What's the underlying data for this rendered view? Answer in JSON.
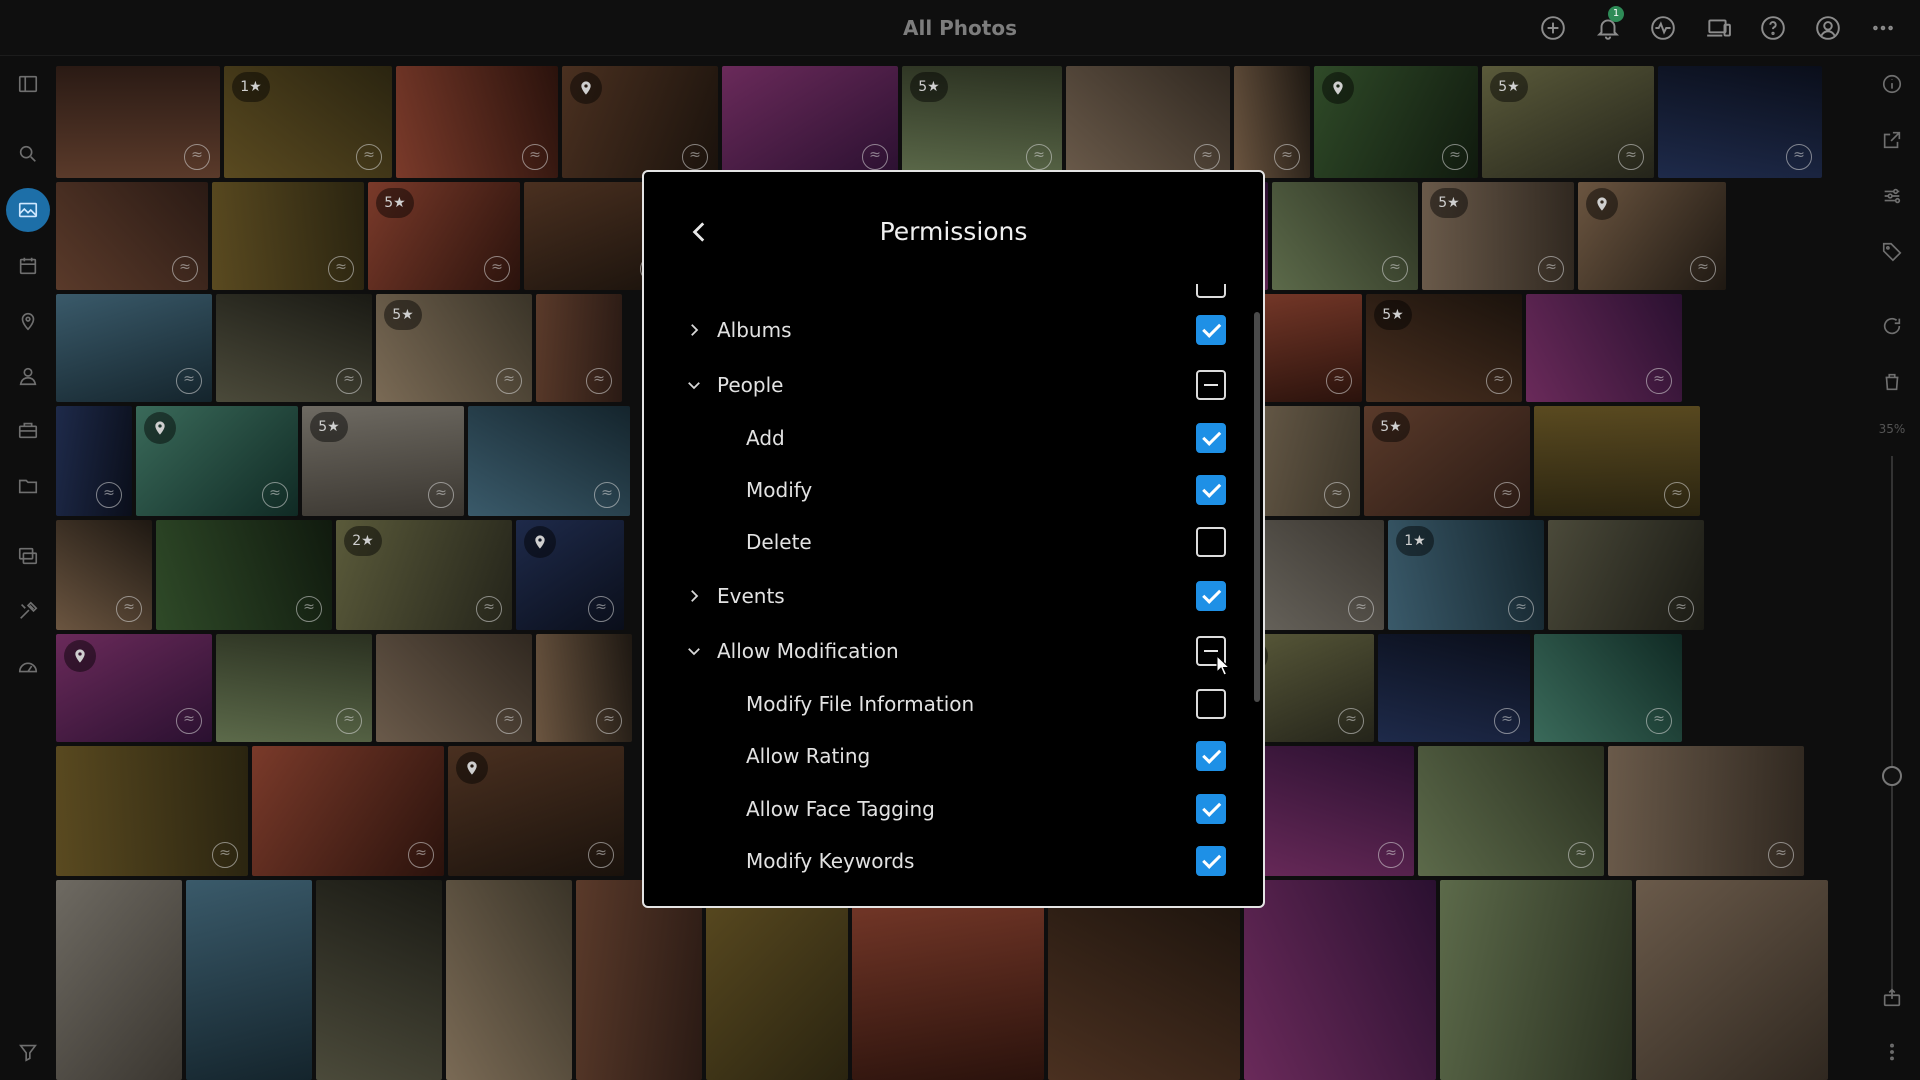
{
  "topbar": {
    "title": "All Photos",
    "notification_count": "1",
    "actions": [
      "add-icon",
      "bell-icon",
      "activity-icon",
      "devices-icon",
      "help-icon",
      "account-icon",
      "more-icon"
    ]
  },
  "leftbar": {
    "items": [
      "sidebar-toggle-icon",
      "search-icon",
      "photos-icon",
      "calendar-icon",
      "places-icon",
      "people-icon",
      "things-icon",
      "folder-icon",
      "albums-icon",
      "tools-icon",
      "dashboard-icon",
      "filter-icon"
    ],
    "active": "photos-icon"
  },
  "rightbar": {
    "items": [
      "info-icon",
      "open-external-icon",
      "adjust-icon",
      "tag-icon",
      "rotate-icon",
      "trash-icon",
      "share-icon",
      "more-vertical-icon"
    ],
    "zoom_label": "35%"
  },
  "modal": {
    "title": "Permissions",
    "rows": [
      {
        "label": "Albums",
        "level": "parent",
        "expanded": false,
        "state": "checked"
      },
      {
        "label": "People",
        "level": "parent",
        "expanded": true,
        "state": "partial"
      },
      {
        "label": "Add",
        "level": "child",
        "state": "checked"
      },
      {
        "label": "Modify",
        "level": "child",
        "state": "checked"
      },
      {
        "label": "Delete",
        "level": "child",
        "state": "unchecked"
      },
      {
        "label": "Events",
        "level": "parent",
        "expanded": false,
        "state": "checked"
      },
      {
        "label": "Allow Modification",
        "level": "parent",
        "expanded": true,
        "state": "partial"
      },
      {
        "label": "Modify File Information",
        "level": "child",
        "state": "unchecked"
      },
      {
        "label": "Allow Rating",
        "level": "child",
        "state": "checked"
      },
      {
        "label": "Allow Face Tagging",
        "level": "child",
        "state": "checked"
      },
      {
        "label": "Modify Keywords",
        "level": "child",
        "state": "checked"
      }
    ]
  },
  "grid": {
    "badges": [
      "1★",
      "5★",
      "5★",
      "5★",
      "5★",
      "5★",
      "5★",
      "5★",
      "5★",
      "2★",
      "1★"
    ]
  },
  "colors": {
    "accent": "#1e90e6",
    "active_nav": "#1d6fa8",
    "badge": "#2e8b57"
  }
}
